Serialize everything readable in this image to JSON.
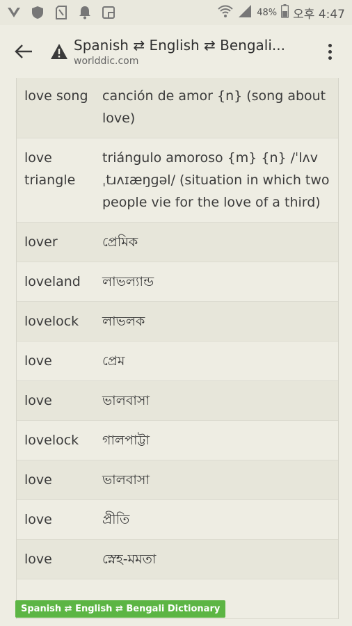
{
  "status_bar": {
    "battery_percent": "48%",
    "time": "오후 4:47"
  },
  "app_bar": {
    "title": "Spanish ⇄ English ⇄ Bengali...",
    "url": "worlddic.com"
  },
  "entries": [
    {
      "term": "love song",
      "definition": "canción de amor {n} (song about love)"
    },
    {
      "term": "love triangle",
      "definition": "triángulo amoroso {m} {n} /ˈlʌv ˌtɹʌɪæŋɡəl/ (situation in which two people vie for the love of a third)"
    },
    {
      "term": "lover",
      "definition": "প্রেমিক"
    },
    {
      "term": "loveland",
      "definition": "লাভল্যান্ড"
    },
    {
      "term": "lovelock",
      "definition": "লাভলক"
    },
    {
      "term": "love",
      "definition": "প্রেম"
    },
    {
      "term": "love",
      "definition": "ভালবাসা"
    },
    {
      "term": "lovelock",
      "definition": "গালপাট্টা"
    },
    {
      "term": "love",
      "definition": "ভালবাসা"
    },
    {
      "term": "love",
      "definition": "প্রীতি"
    },
    {
      "term": "love",
      "definition": "স্নেহ-মমতা"
    }
  ],
  "footer_tag": "Spanish ⇄ English ⇄ Bengali Dictionary",
  "colors": {
    "background": "#eeede3",
    "row_alt": "#e7e6da",
    "tag_green": "#5cb544"
  }
}
